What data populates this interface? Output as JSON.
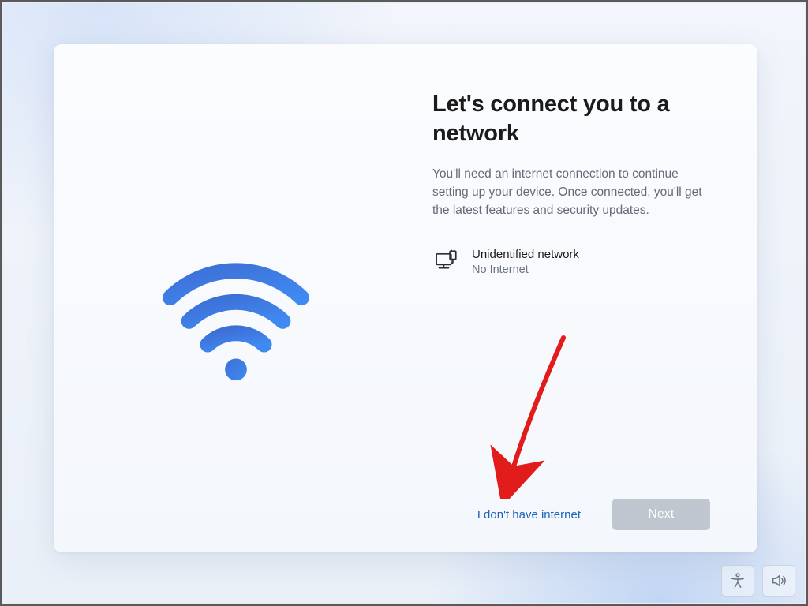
{
  "main": {
    "heading": "Let's connect you to a network",
    "description": "You'll need an internet connection to continue setting up your device. Once connected, you'll get the latest features and security updates."
  },
  "network": {
    "name": "Unidentified network",
    "status": "No Internet"
  },
  "actions": {
    "skip_label": "I don't have internet",
    "next_label": "Next"
  },
  "taskbar": {
    "accessibility_icon": "accessibility",
    "volume_icon": "volume"
  }
}
